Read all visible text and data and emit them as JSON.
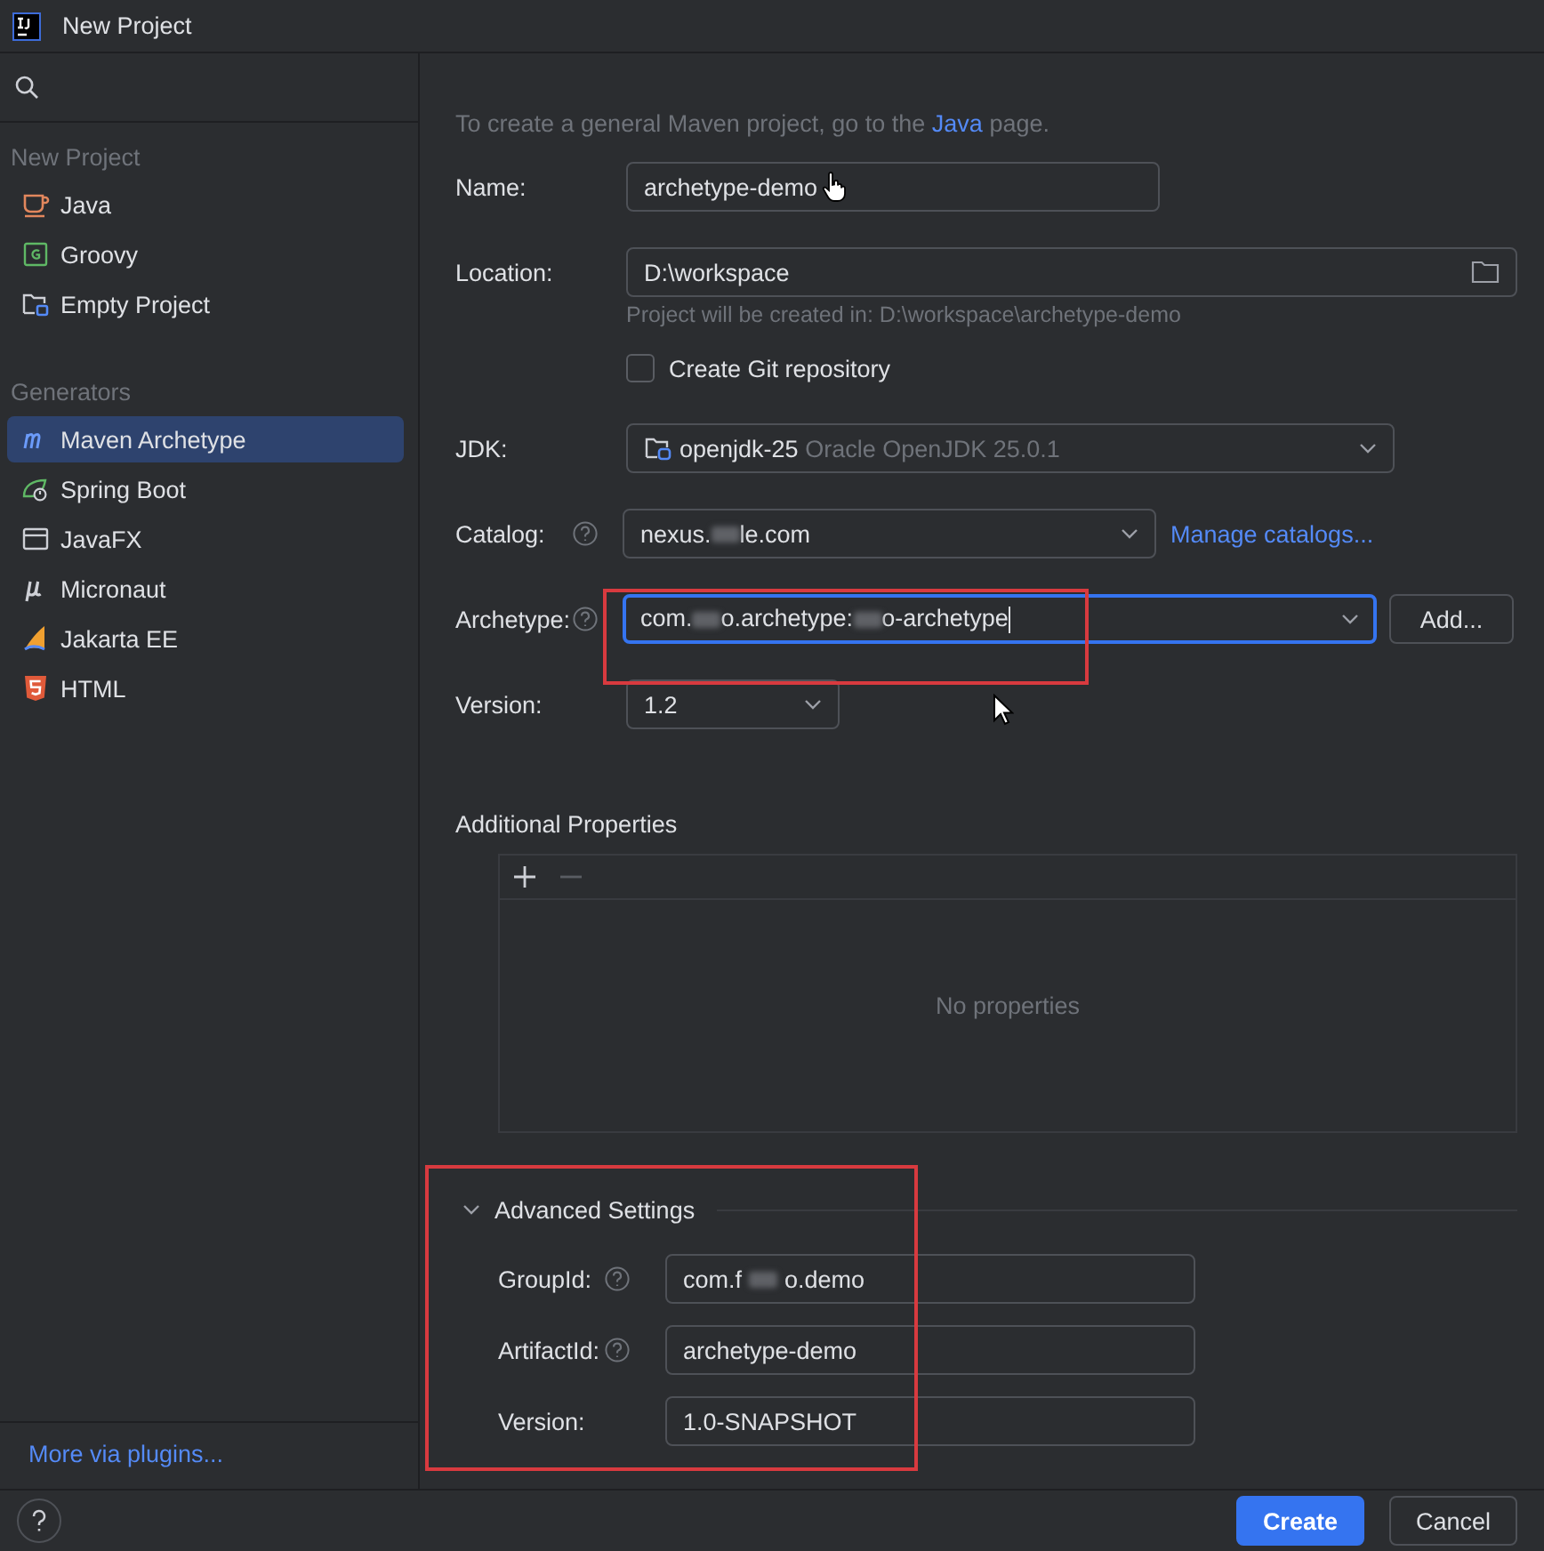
{
  "window": {
    "title": "New Project"
  },
  "sidebar": {
    "sections": [
      {
        "heading": "New Project",
        "items": [
          {
            "label": "Java",
            "kind": "java",
            "selected": false
          },
          {
            "label": "Groovy",
            "kind": "groovy",
            "selected": false
          },
          {
            "label": "Empty Project",
            "kind": "empty",
            "selected": false
          }
        ]
      },
      {
        "heading": "Generators",
        "items": [
          {
            "label": "Maven Archetype",
            "kind": "maven",
            "selected": true
          },
          {
            "label": "Spring Boot",
            "kind": "spring",
            "selected": false
          },
          {
            "label": "JavaFX",
            "kind": "javafx",
            "selected": false
          },
          {
            "label": "Micronaut",
            "kind": "micronaut",
            "selected": false
          },
          {
            "label": "Jakarta EE",
            "kind": "jakarta",
            "selected": false
          },
          {
            "label": "HTML",
            "kind": "html",
            "selected": false
          }
        ]
      }
    ],
    "footer_link": "More via plugins..."
  },
  "form": {
    "intro": {
      "before": "To create a general Maven project, go to the ",
      "link": "Java",
      "after": " page."
    },
    "name": {
      "label": "Name:",
      "value": "archetype-demo"
    },
    "location": {
      "label": "Location:",
      "value": "D:\\workspace",
      "hint": "Project will be created in: D:\\workspace\\archetype-demo"
    },
    "git": {
      "label": "Create Git repository",
      "checked": false
    },
    "jdk": {
      "label": "JDK:",
      "value": "openjdk-25",
      "detail": "Oracle OpenJDK 25.0.1"
    },
    "catalog": {
      "label": "Catalog:",
      "help": true,
      "value_parts": [
        "nexus.",
        "le.com"
      ],
      "link": "Manage catalogs..."
    },
    "archetype": {
      "label": "Archetype:",
      "help": true,
      "focused": true,
      "value_parts": [
        "com.",
        "o.archetype:",
        "o-archetype"
      ],
      "button": "Add..."
    },
    "version": {
      "label": "Version:",
      "value": "1.2"
    }
  },
  "additional_properties": {
    "title": "Additional Properties",
    "empty_text": "No properties"
  },
  "advanced_settings": {
    "title": "Advanced Settings",
    "expanded": true,
    "fields": [
      {
        "label": "GroupId:",
        "help": true,
        "value_parts": [
          "com.f",
          "o.demo"
        ]
      },
      {
        "label": "ArtifactId:",
        "help": true,
        "value_parts": [
          "archetype-demo"
        ]
      },
      {
        "label": "Version:",
        "help": false,
        "value_parts": [
          "1.0-SNAPSHOT"
        ]
      }
    ]
  },
  "buttons": [
    {
      "label": "Create",
      "kind": "primary"
    },
    {
      "label": "Cancel",
      "kind": "secondary"
    }
  ]
}
